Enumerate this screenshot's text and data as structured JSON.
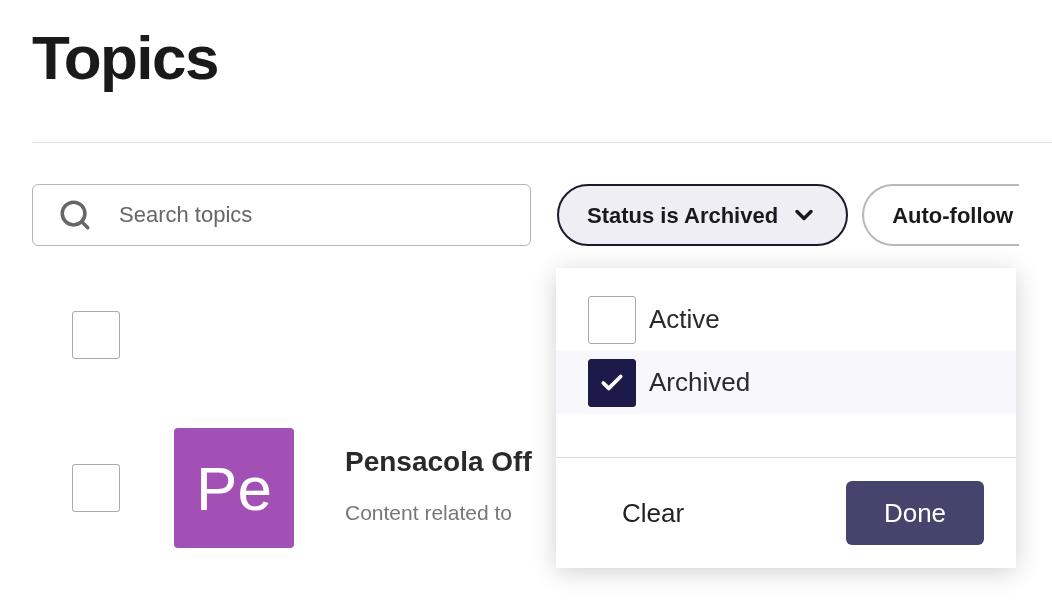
{
  "title": "Topics",
  "search": {
    "placeholder": "Search topics"
  },
  "filters": [
    {
      "label": "Status is Archived",
      "active": true
    },
    {
      "label": "Auto-follow",
      "active": false
    }
  ],
  "status_menu": {
    "options": [
      {
        "label": "Active",
        "checked": false
      },
      {
        "label": "Archived",
        "checked": true
      }
    ],
    "clear": "Clear",
    "done": "Done"
  },
  "select_all": {
    "checked": false
  },
  "topics": [
    {
      "avatar": "Pe",
      "color": "#a24fb6",
      "name": "Pensacola Off",
      "description": "Content related to",
      "checked": false
    }
  ]
}
